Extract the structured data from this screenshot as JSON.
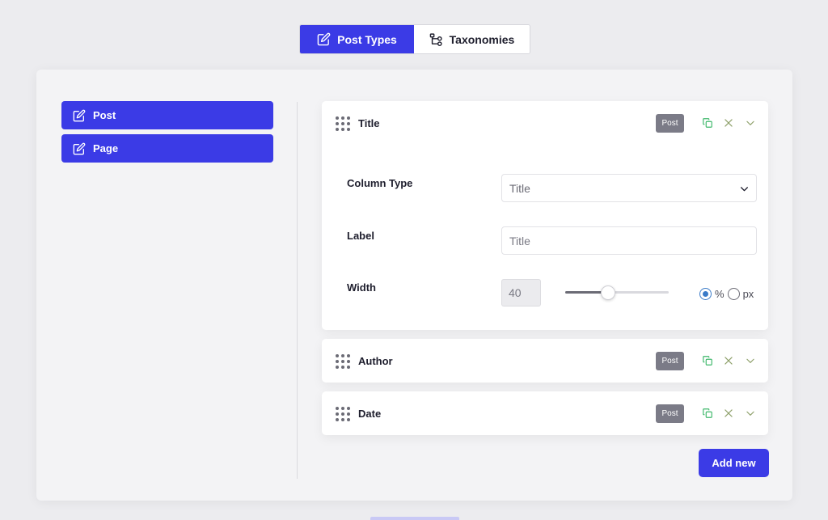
{
  "top_tabs": [
    {
      "label": "Post Types",
      "icon": "edit-icon",
      "active": true
    },
    {
      "label": "Taxonomies",
      "icon": "hierarchy-icon",
      "active": false
    }
  ],
  "sidebar": {
    "items": [
      {
        "label": "Post",
        "icon": "edit-icon"
      },
      {
        "label": "Page",
        "icon": "edit-icon"
      }
    ]
  },
  "columns": [
    {
      "title": "Title",
      "badge": "Post",
      "expanded": true,
      "fields": {
        "column_type_label": "Column Type",
        "column_type_value": "Title",
        "label_label": "Label",
        "label_placeholder": "Title",
        "width_label": "Width",
        "width_value": "40",
        "width_units": [
          "%",
          "px"
        ],
        "width_unit_selected": "%"
      }
    },
    {
      "title": "Author",
      "badge": "Post",
      "expanded": false
    },
    {
      "title": "Date",
      "badge": "Post",
      "expanded": false
    }
  ],
  "add_button": "Add new",
  "colors": {
    "accent": "#3b3be6",
    "badge": "#7b7b87",
    "copy_icon": "#3fb86b",
    "action_icon": "#8ea06a",
    "radio_selected": "#3a7bc8"
  }
}
